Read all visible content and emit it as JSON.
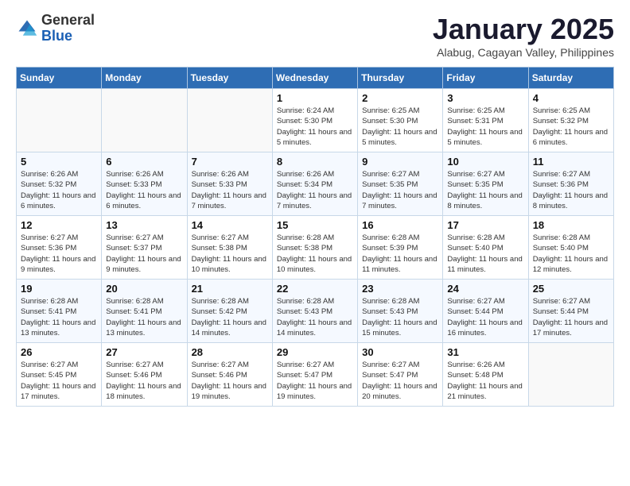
{
  "logo": {
    "general": "General",
    "blue": "Blue"
  },
  "title": "January 2025",
  "subtitle": "Alabug, Cagayan Valley, Philippines",
  "weekdays": [
    "Sunday",
    "Monday",
    "Tuesday",
    "Wednesday",
    "Thursday",
    "Friday",
    "Saturday"
  ],
  "weeks": [
    [
      {
        "day": "",
        "sunrise": "",
        "sunset": "",
        "daylight": ""
      },
      {
        "day": "",
        "sunrise": "",
        "sunset": "",
        "daylight": ""
      },
      {
        "day": "",
        "sunrise": "",
        "sunset": "",
        "daylight": ""
      },
      {
        "day": "1",
        "sunrise": "Sunrise: 6:24 AM",
        "sunset": "Sunset: 5:30 PM",
        "daylight": "Daylight: 11 hours and 5 minutes."
      },
      {
        "day": "2",
        "sunrise": "Sunrise: 6:25 AM",
        "sunset": "Sunset: 5:30 PM",
        "daylight": "Daylight: 11 hours and 5 minutes."
      },
      {
        "day": "3",
        "sunrise": "Sunrise: 6:25 AM",
        "sunset": "Sunset: 5:31 PM",
        "daylight": "Daylight: 11 hours and 5 minutes."
      },
      {
        "day": "4",
        "sunrise": "Sunrise: 6:25 AM",
        "sunset": "Sunset: 5:32 PM",
        "daylight": "Daylight: 11 hours and 6 minutes."
      }
    ],
    [
      {
        "day": "5",
        "sunrise": "Sunrise: 6:26 AM",
        "sunset": "Sunset: 5:32 PM",
        "daylight": "Daylight: 11 hours and 6 minutes."
      },
      {
        "day": "6",
        "sunrise": "Sunrise: 6:26 AM",
        "sunset": "Sunset: 5:33 PM",
        "daylight": "Daylight: 11 hours and 6 minutes."
      },
      {
        "day": "7",
        "sunrise": "Sunrise: 6:26 AM",
        "sunset": "Sunset: 5:33 PM",
        "daylight": "Daylight: 11 hours and 7 minutes."
      },
      {
        "day": "8",
        "sunrise": "Sunrise: 6:26 AM",
        "sunset": "Sunset: 5:34 PM",
        "daylight": "Daylight: 11 hours and 7 minutes."
      },
      {
        "day": "9",
        "sunrise": "Sunrise: 6:27 AM",
        "sunset": "Sunset: 5:35 PM",
        "daylight": "Daylight: 11 hours and 7 minutes."
      },
      {
        "day": "10",
        "sunrise": "Sunrise: 6:27 AM",
        "sunset": "Sunset: 5:35 PM",
        "daylight": "Daylight: 11 hours and 8 minutes."
      },
      {
        "day": "11",
        "sunrise": "Sunrise: 6:27 AM",
        "sunset": "Sunset: 5:36 PM",
        "daylight": "Daylight: 11 hours and 8 minutes."
      }
    ],
    [
      {
        "day": "12",
        "sunrise": "Sunrise: 6:27 AM",
        "sunset": "Sunset: 5:36 PM",
        "daylight": "Daylight: 11 hours and 9 minutes."
      },
      {
        "day": "13",
        "sunrise": "Sunrise: 6:27 AM",
        "sunset": "Sunset: 5:37 PM",
        "daylight": "Daylight: 11 hours and 9 minutes."
      },
      {
        "day": "14",
        "sunrise": "Sunrise: 6:27 AM",
        "sunset": "Sunset: 5:38 PM",
        "daylight": "Daylight: 11 hours and 10 minutes."
      },
      {
        "day": "15",
        "sunrise": "Sunrise: 6:28 AM",
        "sunset": "Sunset: 5:38 PM",
        "daylight": "Daylight: 11 hours and 10 minutes."
      },
      {
        "day": "16",
        "sunrise": "Sunrise: 6:28 AM",
        "sunset": "Sunset: 5:39 PM",
        "daylight": "Daylight: 11 hours and 11 minutes."
      },
      {
        "day": "17",
        "sunrise": "Sunrise: 6:28 AM",
        "sunset": "Sunset: 5:40 PM",
        "daylight": "Daylight: 11 hours and 11 minutes."
      },
      {
        "day": "18",
        "sunrise": "Sunrise: 6:28 AM",
        "sunset": "Sunset: 5:40 PM",
        "daylight": "Daylight: 11 hours and 12 minutes."
      }
    ],
    [
      {
        "day": "19",
        "sunrise": "Sunrise: 6:28 AM",
        "sunset": "Sunset: 5:41 PM",
        "daylight": "Daylight: 11 hours and 13 minutes."
      },
      {
        "day": "20",
        "sunrise": "Sunrise: 6:28 AM",
        "sunset": "Sunset: 5:41 PM",
        "daylight": "Daylight: 11 hours and 13 minutes."
      },
      {
        "day": "21",
        "sunrise": "Sunrise: 6:28 AM",
        "sunset": "Sunset: 5:42 PM",
        "daylight": "Daylight: 11 hours and 14 minutes."
      },
      {
        "day": "22",
        "sunrise": "Sunrise: 6:28 AM",
        "sunset": "Sunset: 5:43 PM",
        "daylight": "Daylight: 11 hours and 14 minutes."
      },
      {
        "day": "23",
        "sunrise": "Sunrise: 6:28 AM",
        "sunset": "Sunset: 5:43 PM",
        "daylight": "Daylight: 11 hours and 15 minutes."
      },
      {
        "day": "24",
        "sunrise": "Sunrise: 6:27 AM",
        "sunset": "Sunset: 5:44 PM",
        "daylight": "Daylight: 11 hours and 16 minutes."
      },
      {
        "day": "25",
        "sunrise": "Sunrise: 6:27 AM",
        "sunset": "Sunset: 5:44 PM",
        "daylight": "Daylight: 11 hours and 17 minutes."
      }
    ],
    [
      {
        "day": "26",
        "sunrise": "Sunrise: 6:27 AM",
        "sunset": "Sunset: 5:45 PM",
        "daylight": "Daylight: 11 hours and 17 minutes."
      },
      {
        "day": "27",
        "sunrise": "Sunrise: 6:27 AM",
        "sunset": "Sunset: 5:46 PM",
        "daylight": "Daylight: 11 hours and 18 minutes."
      },
      {
        "day": "28",
        "sunrise": "Sunrise: 6:27 AM",
        "sunset": "Sunset: 5:46 PM",
        "daylight": "Daylight: 11 hours and 19 minutes."
      },
      {
        "day": "29",
        "sunrise": "Sunrise: 6:27 AM",
        "sunset": "Sunset: 5:47 PM",
        "daylight": "Daylight: 11 hours and 19 minutes."
      },
      {
        "day": "30",
        "sunrise": "Sunrise: 6:27 AM",
        "sunset": "Sunset: 5:47 PM",
        "daylight": "Daylight: 11 hours and 20 minutes."
      },
      {
        "day": "31",
        "sunrise": "Sunrise: 6:26 AM",
        "sunset": "Sunset: 5:48 PM",
        "daylight": "Daylight: 11 hours and 21 minutes."
      },
      {
        "day": "",
        "sunrise": "",
        "sunset": "",
        "daylight": ""
      }
    ]
  ]
}
